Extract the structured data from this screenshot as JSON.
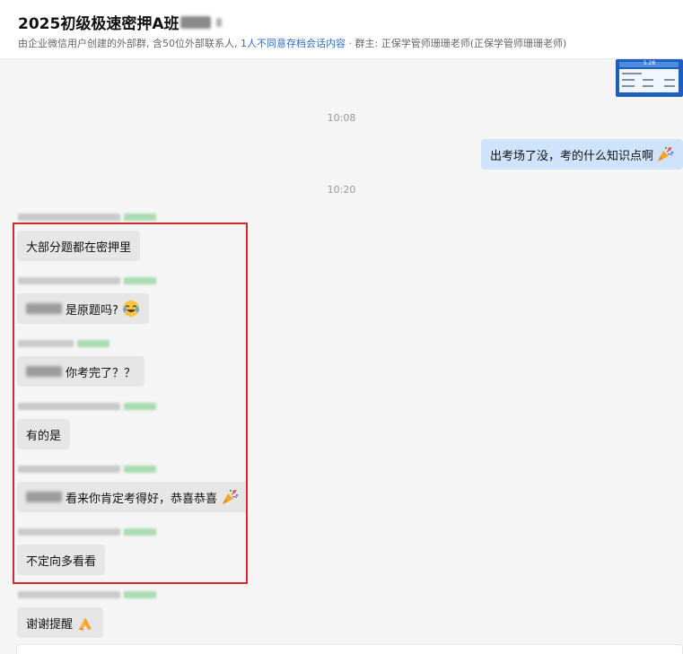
{
  "header": {
    "title": "2025初级极速密押A班",
    "subtitle_prefix": "由企业微信用户创建的外部群, 含50位外部联系人,",
    "subtitle_link": "1人不同意存档会话内容",
    "subtitle_suffix": "· 群主: 正保学管师珊珊老师(正保学管师珊珊老师)"
  },
  "thumbnail": {
    "heading": "5.28"
  },
  "timestamps": [
    "10:08",
    "10:20"
  ],
  "outgoing": {
    "text": "出考场了没，考的什么知识点啊",
    "icon": "party-popper-icon"
  },
  "messages": [
    {
      "text": "大部分题都在密押里"
    },
    {
      "text": "是原题吗?",
      "has_mention": true,
      "icon": "crying-laughing-face-icon"
    },
    {
      "text": "你考完了？？",
      "has_mention": true
    },
    {
      "text": "有的是"
    },
    {
      "text": "看来你肯定考得好，恭喜恭喜",
      "has_mention": true,
      "icon": "party-popper-icon"
    },
    {
      "text": "不定向多看看"
    },
    {
      "text": "谢谢提醒",
      "icon": "folded-hands-icon"
    }
  ],
  "colors": {
    "accent_link": "#2f6ec8",
    "highlight_box": "#d42b2b",
    "outgoing_bubble": "#cfe4fb"
  }
}
